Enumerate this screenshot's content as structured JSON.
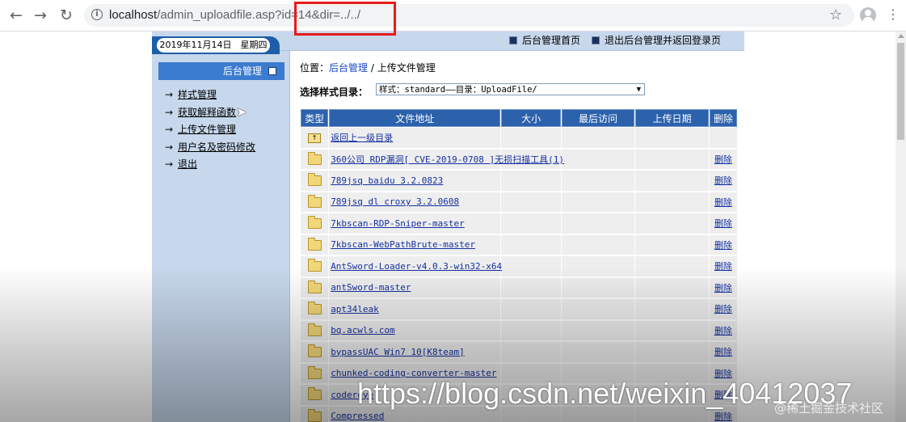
{
  "browser": {
    "url_host": "localhost",
    "url_path": "/admin_uploadfile.asp?id=14&dir=../../",
    "back_glyph": "←",
    "forward_glyph": "→",
    "reload_glyph": "↻",
    "info_glyph": "i",
    "star_glyph": "☆",
    "menu_glyph": "⋮"
  },
  "topbar": {
    "date": "2019年11月14日　星期四",
    "link_home": "后台管理首页",
    "link_logout": "退出后台管理并返回登录页"
  },
  "sidebar": {
    "header": "后台管理",
    "arrow": "→",
    "items": [
      {
        "label": "样式管理"
      },
      {
        "label": "获取解释函数"
      },
      {
        "label": "上传文件管理"
      },
      {
        "label": "用户名及密码修改"
      },
      {
        "label": "退出"
      }
    ]
  },
  "main": {
    "breadcrumb_prefix": "位置：",
    "breadcrumb_link": "后台管理",
    "breadcrumb_sep": " / ",
    "breadcrumb_current": "上传文件管理",
    "style_label": "选择样式目录：",
    "style_select_value": "样式：standard——目录：UploadFile/",
    "dropdown_glyph": "▼"
  },
  "table": {
    "headers": {
      "type": "类型",
      "path": "文件地址",
      "size": "大小",
      "accessed": "最后访问",
      "uploaded": "上传日期",
      "delete": "删除"
    },
    "up_label": "返回上一级目录",
    "up_glyph": "↑",
    "delete_label": "删除",
    "rows": [
      {
        "name": "360公司 RDP漏洞[ CVE-2019-0708 ]无损扫描工具(1)"
      },
      {
        "name": "789jsq baidu 3.2.0823"
      },
      {
        "name": "789jsq dl croxy 3.2.0608"
      },
      {
        "name": "7kbscan-RDP-Sniper-master"
      },
      {
        "name": "7kbscan-WebPathBrute-master"
      },
      {
        "name": "AntSword-Loader-v4.0.3-win32-x64"
      },
      {
        "name": "antSword-master"
      },
      {
        "name": "apt34leak"
      },
      {
        "name": "bq.acwls.com"
      },
      {
        "name": "bypassUAC Win7 10[K8team]"
      },
      {
        "name": "chunked-coding-converter-master"
      },
      {
        "name": "codereye"
      },
      {
        "name": "Compressed"
      }
    ]
  },
  "overlay": {
    "watermark": "https://blog.csdn.net/weixin_40412037",
    "watermark2": "@稀土掘金技术社区"
  },
  "colors": {
    "frame_bg": "#c7d8ec",
    "header_blue": "#2c61ac",
    "highlight_red": "#e81b1b"
  }
}
